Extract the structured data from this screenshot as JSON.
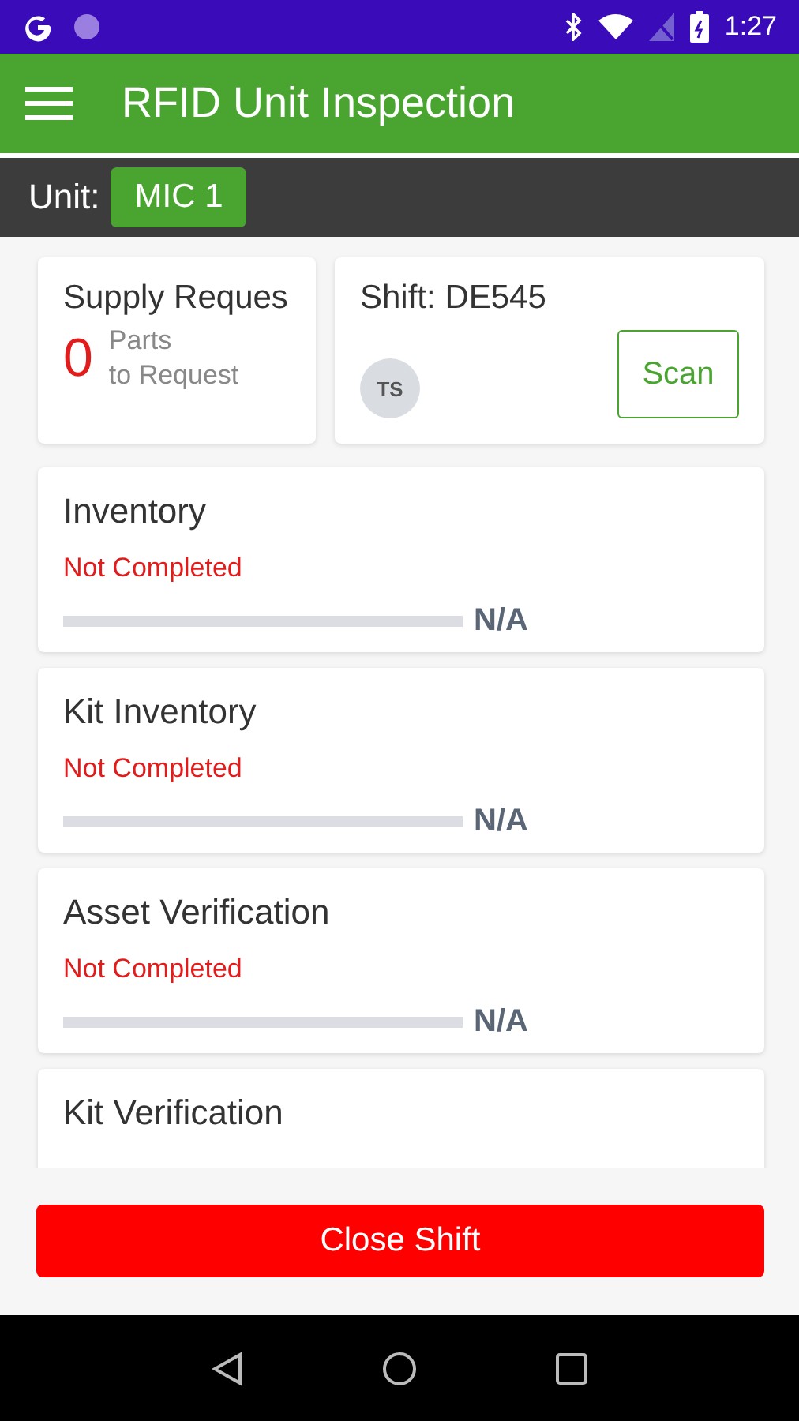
{
  "status_bar": {
    "time": "1:27"
  },
  "app_bar": {
    "title": "RFID Unit Inspection"
  },
  "unit": {
    "label": "Unit:",
    "value": "MIC 1"
  },
  "supply": {
    "title": "Supply Reques",
    "count": "0",
    "caption_1": "Parts",
    "caption_2": "to Request"
  },
  "shift": {
    "title": "Shift: DE545",
    "avatar": "TS",
    "scan_button": "Scan"
  },
  "tasks": [
    {
      "title": "Inventory",
      "status": "Not Completed",
      "completed": false,
      "level": 0,
      "reading": "N/A"
    },
    {
      "title": "Kit Inventory",
      "status": "Not Completed",
      "completed": false,
      "level": 0,
      "reading": "N/A"
    },
    {
      "title": "Asset Verification",
      "status": "Not Completed",
      "completed": false,
      "level": 0,
      "reading": "N/A"
    },
    {
      "title": "Kit Verification"
    }
  ],
  "close_button": "Close Shift"
}
